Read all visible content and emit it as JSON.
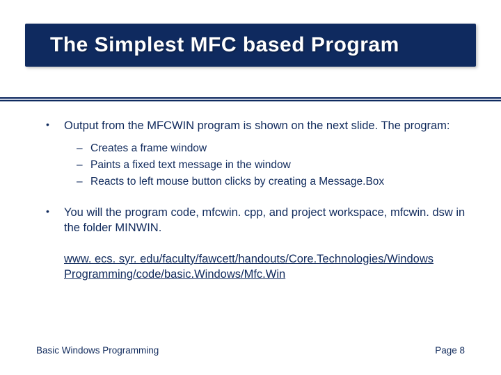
{
  "slide": {
    "title": "The Simplest MFC based Program",
    "bullets": [
      {
        "text": "Output from the MFCWIN program is shown on the next slide.  The program:",
        "sub": [
          "Creates a frame window",
          "Paints a fixed text message in the window",
          "Reacts to left mouse button clicks by creating a Message.Box"
        ]
      },
      {
        "text": "You will the program code, mfcwin. cpp, and project workspace, mfcwin. dsw in the folder MINWIN.",
        "sub": []
      }
    ],
    "link": "www. ecs. syr. edu/faculty/fawcett/handouts/Core.Technologies/Windows Programming/code/basic.Windows/Mfc.Win",
    "footer_left": "Basic Windows Programming",
    "footer_right": "Page 8"
  }
}
